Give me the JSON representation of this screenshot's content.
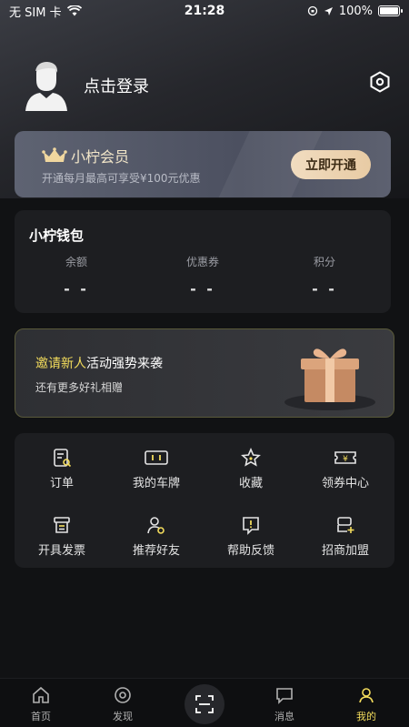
{
  "status_bar": {
    "carrier": "无 SIM 卡",
    "time": "21:28",
    "battery_pct": "100%"
  },
  "profile": {
    "login_text": "点击登录"
  },
  "vip": {
    "title": "小柠会员",
    "subtitle": "开通每月最高可享受¥100元优惠",
    "button": "立即开通"
  },
  "wallet": {
    "title": "小柠钱包",
    "items": [
      {
        "label": "余额",
        "value": "- -"
      },
      {
        "label": "优惠券",
        "value": "- -"
      },
      {
        "label": "积分",
        "value": "- -"
      }
    ]
  },
  "invite": {
    "highlight": "邀请新人",
    "title_rest": "活动强势来袭",
    "subtitle": "还有更多好礼相赠"
  },
  "menu": {
    "items": [
      {
        "label": "订单",
        "icon": "order-icon"
      },
      {
        "label": "我的车牌",
        "icon": "license-plate-icon"
      },
      {
        "label": "收藏",
        "icon": "star-icon"
      },
      {
        "label": "领券中心",
        "icon": "coupon-icon"
      },
      {
        "label": "开具发票",
        "icon": "invoice-icon"
      },
      {
        "label": "推荐好友",
        "icon": "recommend-friend-icon"
      },
      {
        "label": "帮助反馈",
        "icon": "help-feedback-icon"
      },
      {
        "label": "招商加盟",
        "icon": "franchise-icon"
      }
    ]
  },
  "tabbar": {
    "items": [
      {
        "label": "首页",
        "icon": "home-icon"
      },
      {
        "label": "发现",
        "icon": "discover-icon"
      },
      {
        "label": "消息",
        "icon": "message-icon"
      },
      {
        "label": "我的",
        "icon": "me-icon"
      }
    ]
  },
  "colors": {
    "accent": "#f3dc5c",
    "vip_button": "#f1dcc0",
    "background": "#111214",
    "card": "#1d1e21"
  }
}
